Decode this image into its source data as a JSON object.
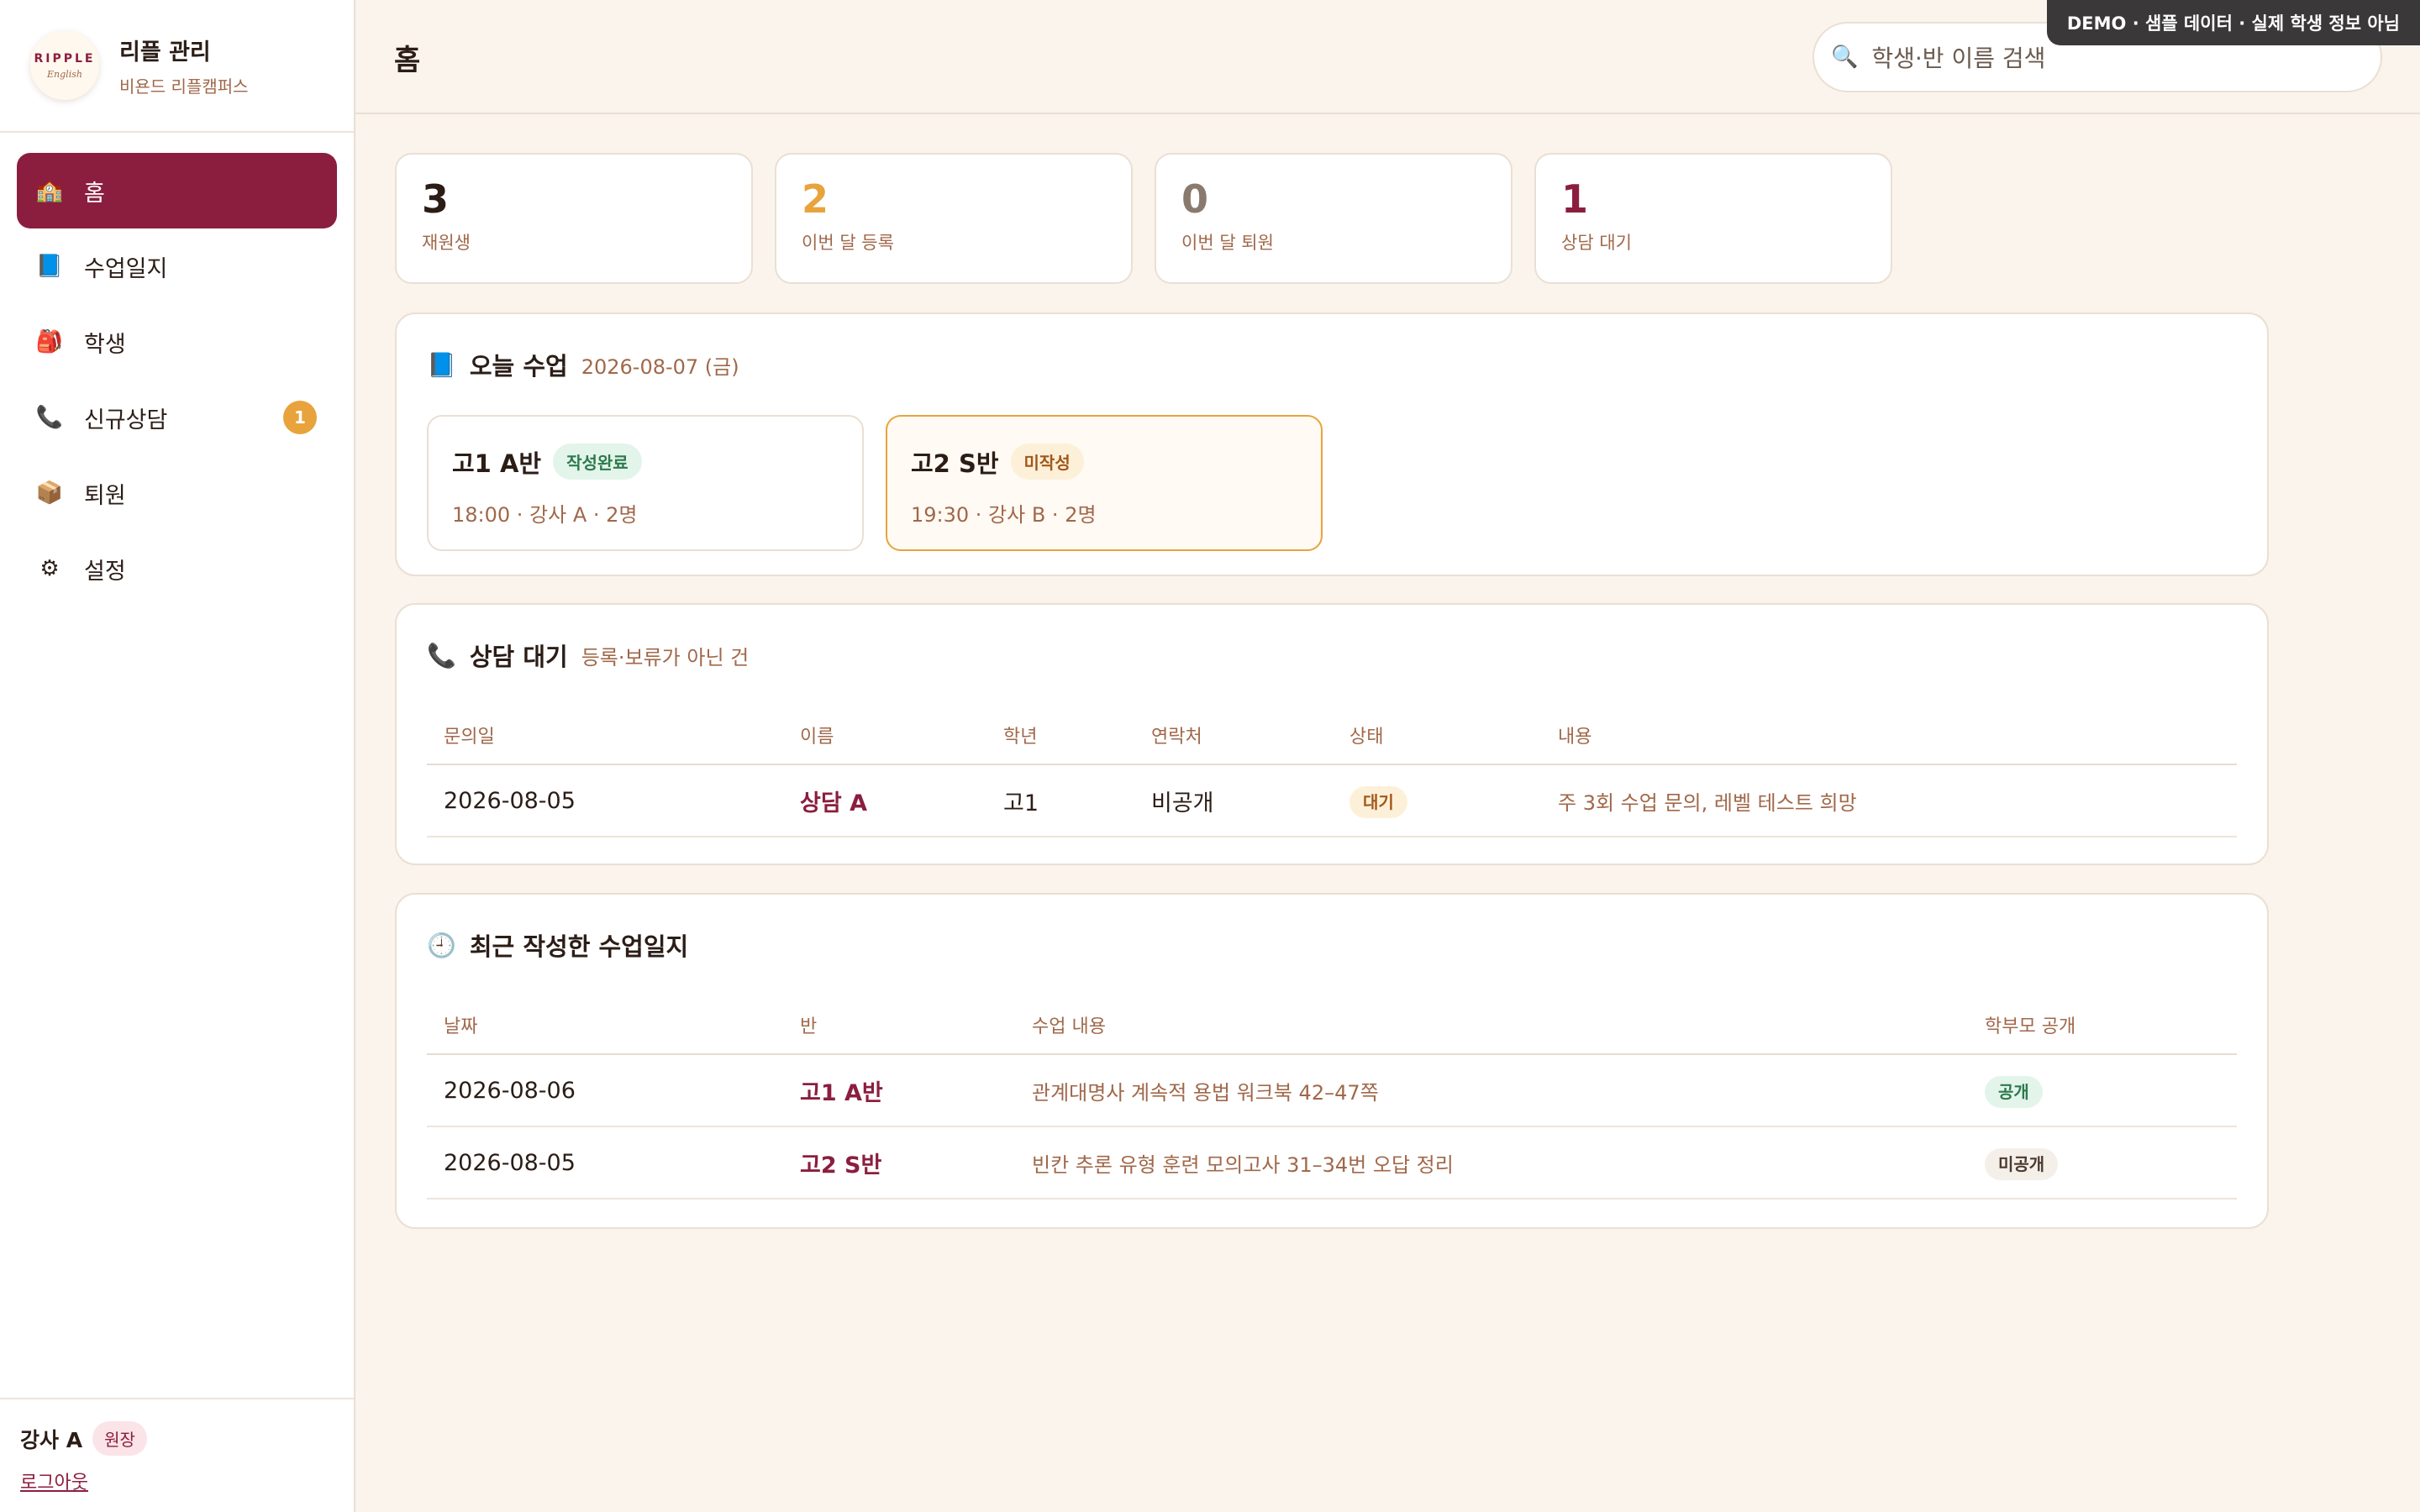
{
  "brand": {
    "logo_top": "RIPPLE",
    "logo_bottom": "English",
    "title": "리플 관리",
    "subtitle": "비욘드 리플캠퍼스"
  },
  "nav": [
    {
      "icon": "school-icon",
      "glyph": "🏫",
      "label": "홈",
      "active": true
    },
    {
      "icon": "book-icon",
      "glyph": "📘",
      "label": "수업일지"
    },
    {
      "icon": "backpack-icon",
      "glyph": "🎒",
      "label": "학생"
    },
    {
      "icon": "phone-icon",
      "glyph": "📞",
      "label": "신규상담",
      "badge": "1"
    },
    {
      "icon": "box-icon",
      "glyph": "📦",
      "label": "퇴원"
    },
    {
      "icon": "gear-icon",
      "glyph": "⚙",
      "label": "설정"
    }
  ],
  "footer": {
    "user": "강사 A",
    "role": "원장",
    "logout": "로그아웃"
  },
  "header": {
    "title": "홈",
    "search_placeholder": "학생·반 이름 검색",
    "demo_banner": "DEMO · 샘플 데이터 · 실제 학생 정보 아님"
  },
  "stats": [
    {
      "value": "3",
      "label": "재원생",
      "color": "#2b1d16"
    },
    {
      "value": "2",
      "label": "이번 달 등록",
      "color": "#e8a33d"
    },
    {
      "value": "0",
      "label": "이번 달 퇴원",
      "color": "#8a7a6e"
    },
    {
      "value": "1",
      "label": "상담 대기",
      "color": "#8b1e3f"
    }
  ],
  "today": {
    "title": "오늘 수업",
    "date": "2026-08-07 (금)",
    "classes": [
      {
        "name": "고1 A반",
        "status": "작성완료",
        "meta": "18:00 · 강사 A · 2명"
      },
      {
        "name": "고2 S반",
        "status": "미작성",
        "meta": "19:30 · 강사 B · 2명"
      }
    ]
  },
  "consult": {
    "title": "상담 대기",
    "subtitle": "등록·보류가 아닌 건",
    "headers": [
      "문의일",
      "이름",
      "학년",
      "연락처",
      "상태",
      "내용"
    ],
    "rows": [
      {
        "date": "2026-08-05",
        "name": "상담 A",
        "grade": "고1",
        "contact": "비공개",
        "status": "대기",
        "content": "주 3회 수업 문의, 레벨 테스트 희망"
      }
    ]
  },
  "logs": {
    "title": "최근 작성한 수업일지",
    "headers": [
      "날짜",
      "반",
      "수업 내용",
      "학부모 공개"
    ],
    "rows": [
      {
        "date": "2026-08-06",
        "class": "고1 A반",
        "content": "관계대명사 계속적 용법 워크북 42–47쪽",
        "visibility": "공개"
      },
      {
        "date": "2026-08-05",
        "class": "고2 S반",
        "content": "빈칸 추론 유형 훈련 모의고사 31–34번 오답 정리",
        "visibility": "미공개"
      }
    ]
  }
}
